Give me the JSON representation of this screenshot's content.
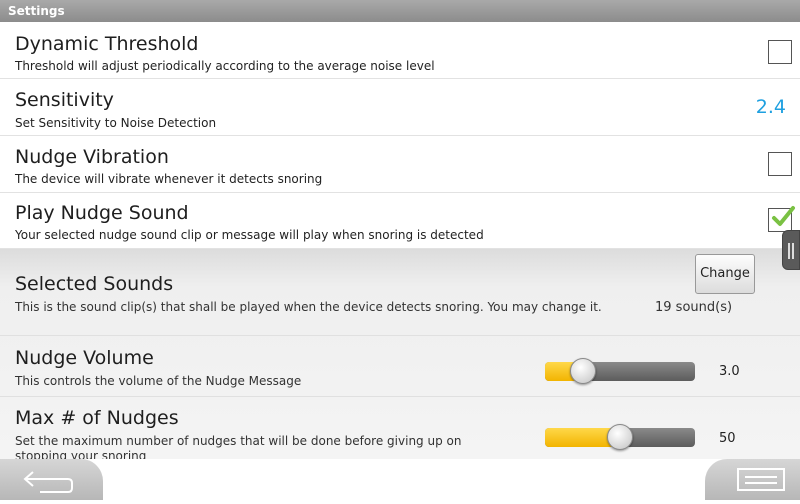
{
  "window": {
    "title": "Settings"
  },
  "preferences": [
    {
      "title": "Dynamic Threshold",
      "summary": "Threshold will adjust periodically according to the average noise level",
      "checked": false
    },
    {
      "title": "Sensitivity",
      "summary": "Set Sensitivity to Noise Detection",
      "value": "2.4"
    },
    {
      "title": "Nudge Vibration",
      "summary": "The device will vibrate whenever it detects snoring",
      "checked": false
    },
    {
      "title": "Play Nudge Sound",
      "summary": "Your selected nudge sound clip or message will play when snoring is detected",
      "checked": true
    }
  ],
  "sounds": {
    "title": "Selected Sounds",
    "summary": "This is the sound clip(s) that shall be played when the device detects snoring. You may change it.",
    "button_label": "Change",
    "count": "19 sound(s)"
  },
  "volume": {
    "title": "Nudge Volume",
    "summary": "This controls the volume of the Nudge Message",
    "value": "3.0",
    "level_fraction": 0.25
  },
  "max_nudges": {
    "title": "Max # of Nudges",
    "summary": "Set the maximum number of nudges that will be done before giving up on stopping your snoring",
    "value": "50",
    "level_fraction": 0.5
  },
  "colors": {
    "accent_blue": "#1ea0e0",
    "check_green": "#7ac143",
    "slider_fill": "#f2b400"
  },
  "icons": {
    "back": "back-arrow-icon",
    "menu": "menu-icon",
    "check": "checkmark-icon",
    "handle": "drawer-handle-icon"
  }
}
